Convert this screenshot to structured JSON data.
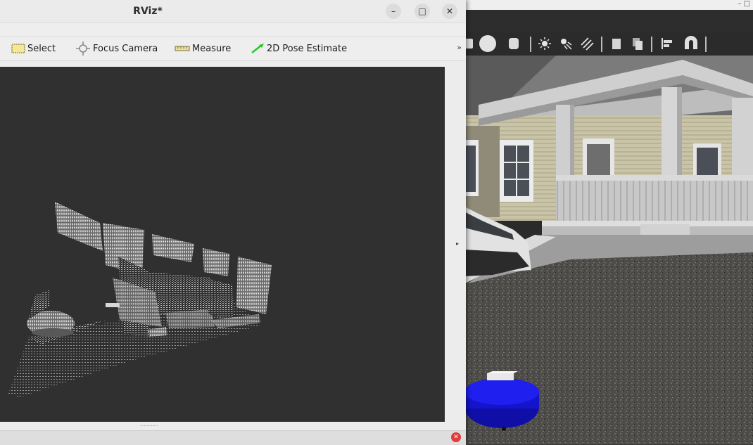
{
  "rviz": {
    "title": "RViz*",
    "window_controls": {
      "minimize": "–",
      "maximize": "□",
      "close": "✕"
    },
    "tools": [
      {
        "label": "Select",
        "icon": "select-icon"
      },
      {
        "label": "Focus Camera",
        "icon": "focus-camera-icon"
      },
      {
        "label": "Measure",
        "icon": "measure-icon"
      },
      {
        "label": "2D Pose Estimate",
        "icon": "pose-estimate-arrow-icon"
      }
    ],
    "more_tools": "»",
    "collapse_arrow": "▸"
  },
  "gazebo": {
    "toolbar_icons": [
      "box-icon",
      "sphere-icon",
      "cylinder-icon",
      "point-light-icon",
      "spot-light-icon",
      "directional-light-icon",
      "copy-icon",
      "paste-icon",
      "align-icon",
      "magnet-icon"
    ]
  },
  "colors": {
    "robot": "#1a1ae6",
    "viewport_bg": "#303030",
    "pose_arrow": "#22cc22"
  }
}
